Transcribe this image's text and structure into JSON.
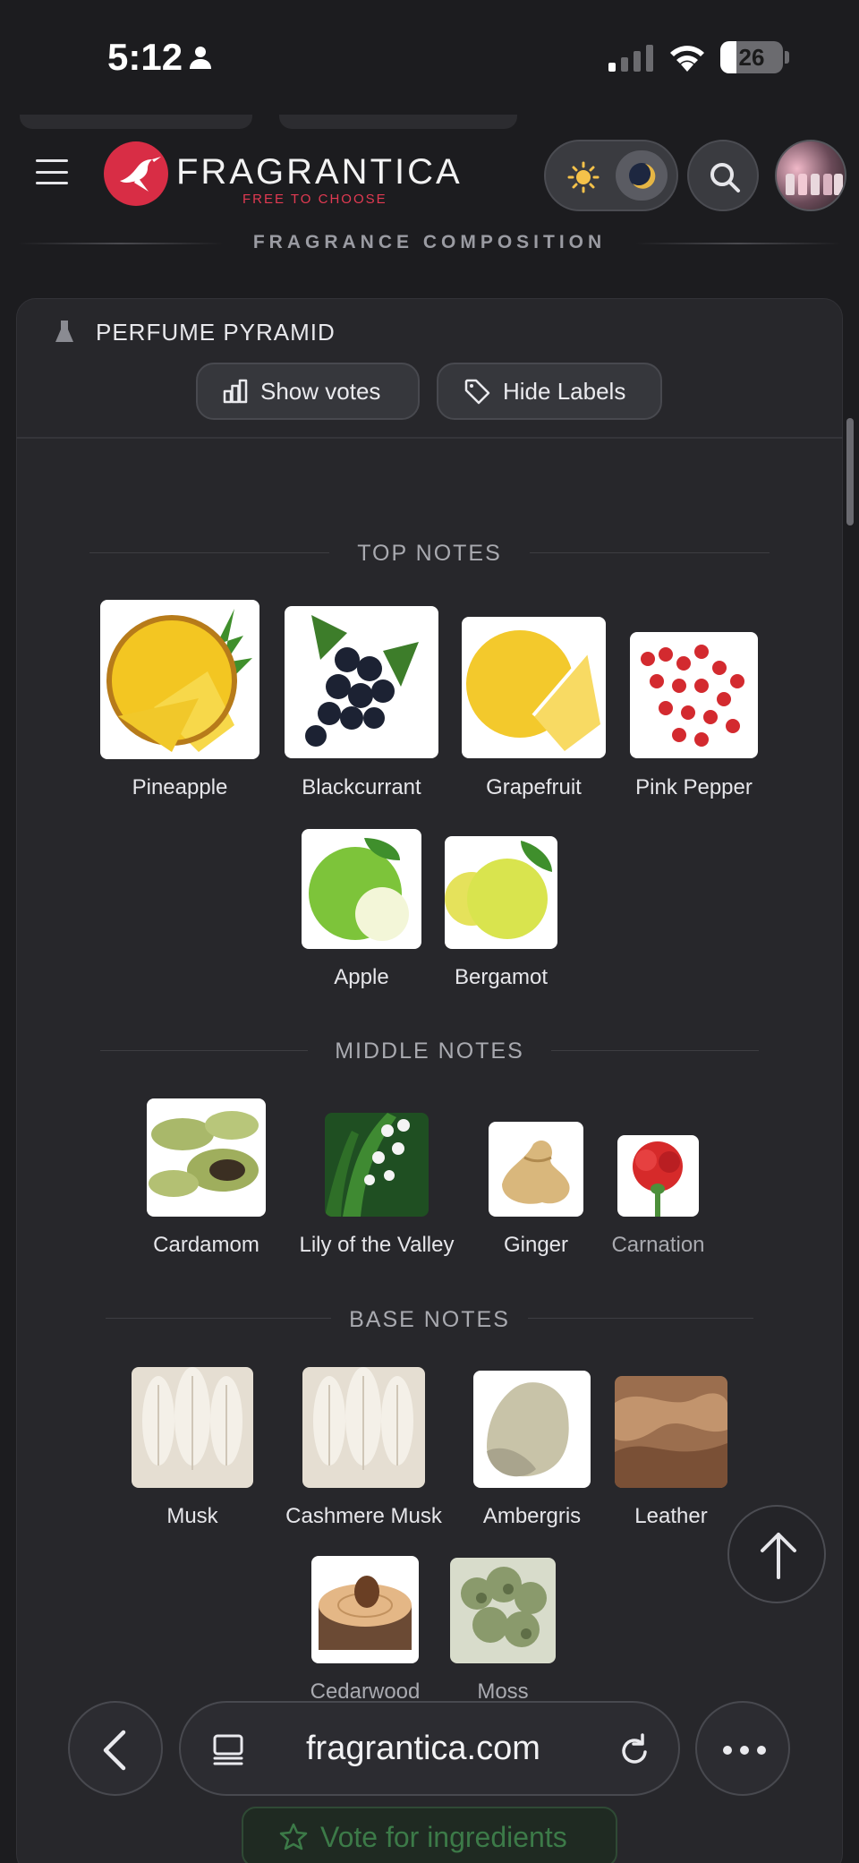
{
  "status_bar": {
    "time": "5:12",
    "battery": "26",
    "battery_level": 0.26
  },
  "header": {
    "logo": "FRAGRANTICA",
    "tagline": "FREE TO CHOOSE"
  },
  "section_caption": "FRAGRANCE COMPOSITION",
  "card": {
    "title": "PERFUME PYRAMID",
    "show_votes": "Show votes",
    "hide_labels": "Hide Labels"
  },
  "top_notes": {
    "title": "TOP NOTES",
    "items": [
      "Pineapple",
      "Blackcurrant",
      "Grapefruit",
      "Pink Pepper",
      "Apple",
      "Bergamot"
    ]
  },
  "middle_notes": {
    "title": "MIDDLE NOTES",
    "items": [
      "Cardamom",
      "Lily of the Valley",
      "Ginger",
      "Carnation"
    ]
  },
  "base_notes": {
    "title": "BASE NOTES",
    "items": [
      "Musk",
      "Cashmere Musk",
      "Ambergris",
      "Leather",
      "Cedarwood",
      "Moss"
    ]
  },
  "browser": {
    "url": "fragrantica.com"
  },
  "vote_button": "Vote for ingredients",
  "colors": {
    "brand": "#d82d45",
    "background": "#1c1c1f",
    "card": "#27272b"
  }
}
